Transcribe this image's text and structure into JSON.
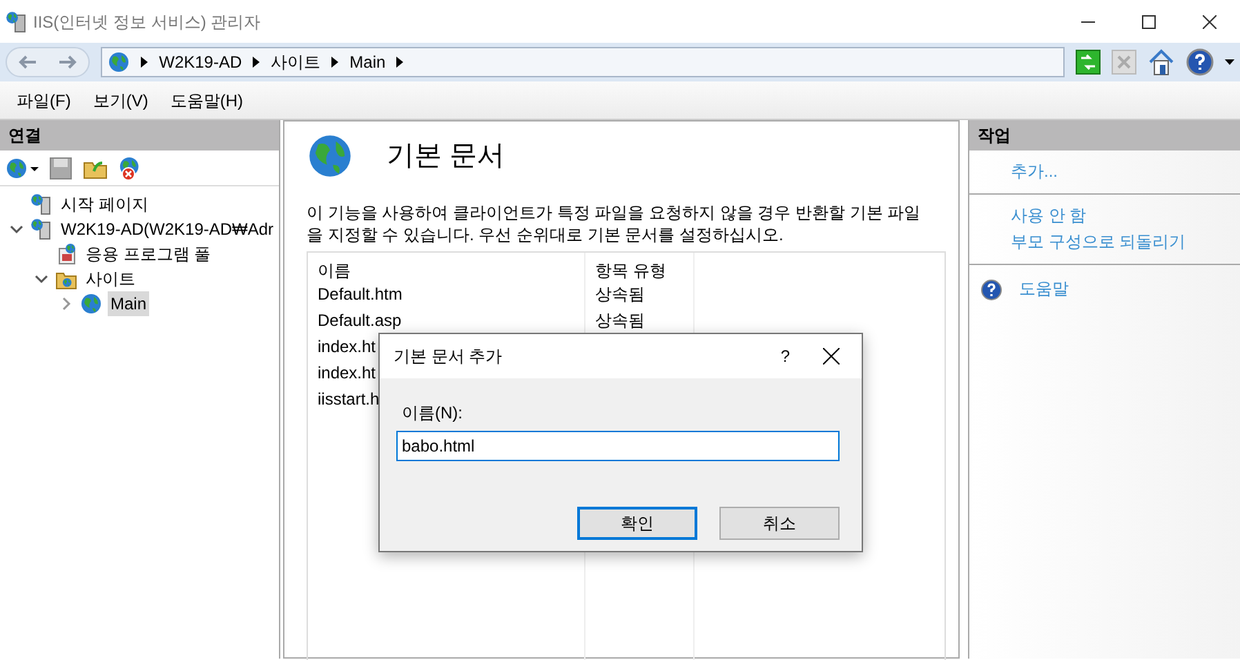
{
  "window": {
    "title": "IIS(인터넷 정보 서비스) 관리자"
  },
  "address_bar": {
    "back_disabled": true,
    "forward_disabled": true,
    "crumbs": [
      "W2K19-AD",
      "사이트",
      "Main"
    ]
  },
  "menu": [
    "파일(F)",
    "보기(V)",
    "도움말(H)"
  ],
  "connections": {
    "title": "연결",
    "tree": [
      {
        "label": "시작 페이지",
        "kind": "start",
        "selected": false
      },
      {
        "label": "W2K19-AD(W2K19-AD₩Adr",
        "kind": "server",
        "expanded": true,
        "selected": false,
        "children": [
          {
            "label": "응용 프로그램 풀",
            "kind": "pool",
            "selected": false
          },
          {
            "label": "사이트",
            "kind": "folder",
            "expanded": true,
            "selected": false,
            "children": [
              {
                "label": "Main",
                "kind": "site",
                "expanded": false,
                "selected": true
              }
            ]
          }
        ]
      }
    ]
  },
  "feature": {
    "title": "기본 문서",
    "description": "이 기능을 사용하여 클라이언트가 특정 파일을 요청하지 않을 경우 반환할 기본 파일을 지정할 수 있습니다. 우선 순위대로 기본 문서를 설정하십시오.",
    "table": {
      "columns": [
        "이름",
        "항목 유형"
      ],
      "rows": [
        [
          "Default.htm",
          "상속됨"
        ],
        [
          "Default.asp",
          "상속됨"
        ],
        [
          "index.ht"
        ],
        [
          "index.ht"
        ],
        [
          "iisstart.h"
        ]
      ]
    }
  },
  "actions": {
    "title": "작업",
    "groups": [
      [
        {
          "label": "추가...",
          "kind": "link"
        }
      ],
      [
        {
          "label": "사용 안 함",
          "kind": "link"
        },
        {
          "label": "부모 구성으로 되돌리기",
          "kind": "link"
        }
      ],
      [
        {
          "label": "도움말",
          "kind": "help"
        }
      ]
    ]
  },
  "dialog": {
    "title": "기본 문서 추가",
    "help": "?",
    "field_label": "이름(N):",
    "value": "babo.html",
    "buttons": [
      {
        "label": "확인",
        "default": true
      },
      {
        "label": "취소",
        "default": false
      }
    ]
  }
}
